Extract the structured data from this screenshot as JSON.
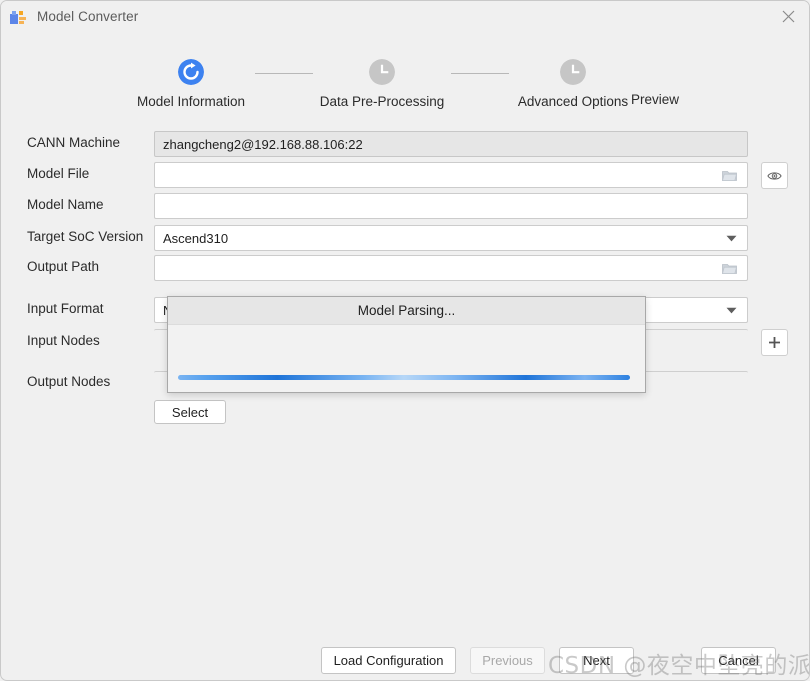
{
  "window": {
    "title": "Model Converter",
    "app_icon": "app-blocks-icon",
    "close_icon": "close-icon"
  },
  "stepper": {
    "steps": [
      {
        "label": "Model Information",
        "icon": "loading-spinner-icon",
        "state": "active",
        "color": "#3d82f0"
      },
      {
        "label": "Data Pre-Processing",
        "icon": "clock-icon",
        "state": "pending",
        "color": "#c4c4c4"
      },
      {
        "label": "Advanced Options",
        "icon": "clock-icon",
        "state": "pending",
        "color": "#c4c4c4"
      },
      {
        "label": "Preview",
        "icon": "",
        "state": "pending",
        "color": "#c4c4c4"
      }
    ]
  },
  "form": {
    "cann_machine": {
      "label": "CANN Machine",
      "value": "zhangcheng2@192.168.88.106:22",
      "placeholder": ""
    },
    "model_file": {
      "label": "Model File",
      "value": "",
      "placeholder": "",
      "browse_icon": "folder-icon",
      "eye_button_icon": "eye-icon"
    },
    "model_name": {
      "label": "Model Name",
      "value": "",
      "placeholder": ""
    },
    "target_soc_version": {
      "label": "Target SoC Version",
      "value": "Ascend310",
      "caret_icon": "chevron-down-icon"
    },
    "output_path": {
      "label": "Output Path",
      "value": "",
      "placeholder": "",
      "browse_icon": "folder-icon"
    },
    "input_format": {
      "label": "Input Format",
      "value": "N",
      "caret_icon": "chevron-down-icon"
    },
    "input_nodes": {
      "label": "Input Nodes",
      "add_button_icon": "plus-icon"
    },
    "output_nodes": {
      "label": "Output Nodes",
      "select_label": "Select"
    }
  },
  "modal": {
    "title": "Model Parsing...",
    "progress_indeterminate": true
  },
  "footer": {
    "load_configuration": "Load Configuration",
    "previous": "Previous",
    "previous_disabled": true,
    "next": "Next",
    "cancel": "Cancel"
  },
  "watermark": {
    "text": "CSDN @夜空中坠亮的派大星"
  }
}
